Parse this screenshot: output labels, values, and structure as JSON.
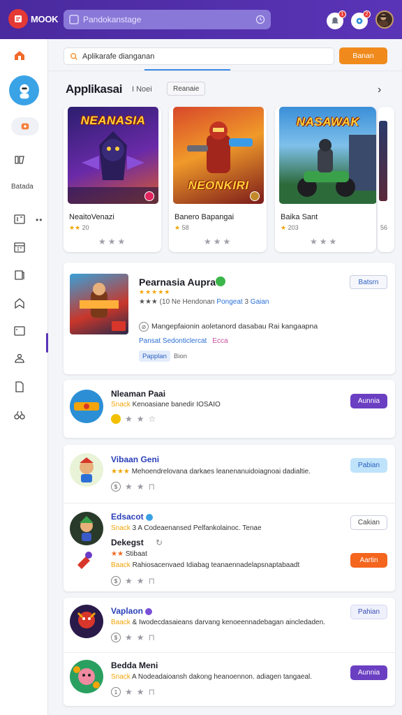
{
  "topbar": {
    "brand": "MOOK",
    "search_placeholder": "Pandokanstage",
    "notif_badge_1": "1",
    "notif_badge_2": "2"
  },
  "sidebar": {
    "label": "Batada"
  },
  "main": {
    "search_value": "Aplikarafe dianganan",
    "search_button": "Banan",
    "section_title": "Applikasai",
    "section_sub": "I Noei",
    "section_chip": "Reanaie",
    "games": [
      {
        "art_title": "NEANASIA",
        "name": "NeaitoVenazi",
        "stars": "★★",
        "rating": "20"
      },
      {
        "art_title": "NEONKIRI",
        "name": "Banero Bapangai",
        "stars": "★",
        "rating": "58"
      },
      {
        "art_title": "NASAWAK",
        "name": "Baika Sant",
        "stars": "★",
        "rating": "203"
      }
    ],
    "game_teaser_rating": "56"
  },
  "featured": {
    "title": "Pearnasia Aupra",
    "stars": "★★★★★",
    "meta_prefix": "★★★ (10 Ne Hendonan",
    "meta_link": "Pongeat",
    "meta_count": "3",
    "meta_link2": "Gaian",
    "description": "Mangepfaionin aoletanord dasabau Rai kangaapna",
    "link1": "Pansat Sedonticlercat",
    "link2": "Ecca",
    "tag": "Papplan",
    "tag2": "Bion",
    "button": "Batsrn"
  },
  "list": [
    {
      "title": "Nleaman Paai",
      "desc_stars": "Snack",
      "desc": "Kenoasiane banedir IOSAIO",
      "button": "Aunnia"
    },
    {
      "title": "Vibaan Geni",
      "desc_stars": "★★★",
      "desc": "Mehoendrelovana darkaes leanenanuidoiagnoai dadialtie.",
      "button": "Pabian"
    },
    {
      "title": "Edsacot",
      "desc_stars": "Snack",
      "desc": "3 A Codeaenansed Pelfankolainoc. Tenae",
      "button": "Cakian"
    },
    {
      "title": "Dekegst",
      "desc_stars": "★★",
      "desc": "Stibaat",
      "desc2_stars": "Baack",
      "desc2": "Rahiosacenvaed Idiabag teanaennadelapsnaptabaadt",
      "button": "Aartin"
    },
    {
      "title": "Vaplaon",
      "desc_stars": "Baack",
      "desc": "& Iwodecdasaieans darvang kenoeennadebagan aincledaden.",
      "button": "Pahian"
    },
    {
      "title": "Bedda Meni",
      "desc_stars": "Snack",
      "desc": "A Nodeadaioansh dakong heanoennon. adiagen tangaeal.",
      "button": "Aunnia"
    }
  ],
  "colors": {
    "topbar": "#4a2a9e",
    "accent_orange": "#f08a1c",
    "accent_purple": "#6b3fc2"
  }
}
